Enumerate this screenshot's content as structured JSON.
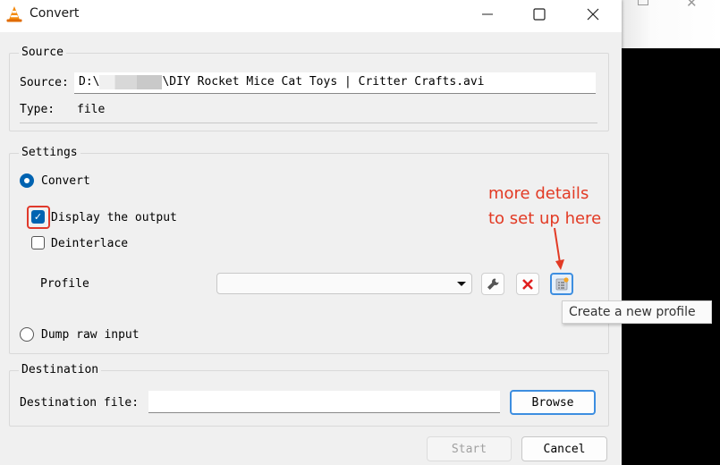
{
  "window": {
    "title": "Convert",
    "controls": {
      "minimize": "—",
      "maximize": "☐",
      "close": "✕"
    }
  },
  "background_window": {
    "maximize_icon": "☐",
    "close_icon": "✕"
  },
  "source": {
    "group_label": "Source",
    "source_label": "Source:",
    "source_prefix": "D:\\",
    "source_suffix": "\\DIY Rocket Mice Cat Toys | Critter Crafts.avi",
    "type_label": "Type:",
    "type_value": "file"
  },
  "settings": {
    "group_label": "Settings",
    "convert_label": "Convert",
    "convert_selected": true,
    "display_output_label": "Display the output",
    "display_output_checked": true,
    "deinterlace_label": "Deinterlace",
    "deinterlace_checked": false,
    "profile_label": "Profile",
    "profile_value": "",
    "profile_buttons": [
      {
        "name": "edit-profile",
        "icon": "wrench-icon"
      },
      {
        "name": "delete-profile",
        "icon": "delete-x-icon"
      },
      {
        "name": "create-profile",
        "icon": "new-profile-icon",
        "tooltip": "Create a new profile"
      }
    ],
    "dump_raw_label": "Dump raw input",
    "dump_raw_selected": false
  },
  "annotation": {
    "line1": "more details",
    "line2": "to set up here",
    "color": "#e23a24"
  },
  "tooltip": "Create a new profile",
  "destination": {
    "group_label": "Destination",
    "file_label": "Destination file:",
    "file_value": "",
    "browse_label": "Browse"
  },
  "footer": {
    "start_label": "Start",
    "cancel_label": "Cancel"
  },
  "colors": {
    "accent": "#0063b1",
    "focus_border": "#3d8ee0",
    "highlight_red": "#e0392b"
  }
}
